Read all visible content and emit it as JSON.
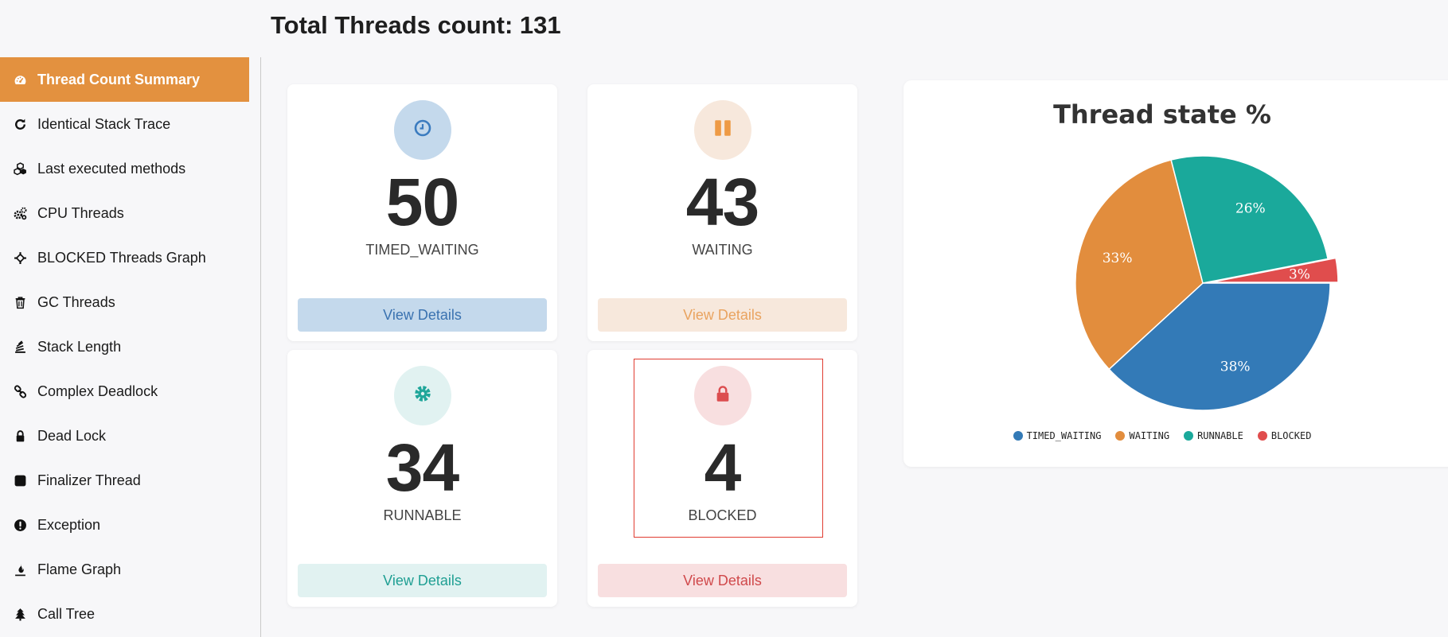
{
  "header": {
    "title": "Total Threads count: 131"
  },
  "sidebar": {
    "items": [
      {
        "label": "Thread Count Summary",
        "icon": "dashboard-icon",
        "active": true
      },
      {
        "label": "Identical Stack Trace",
        "icon": "refresh-icon"
      },
      {
        "label": "Last executed methods",
        "icon": "cubes-icon"
      },
      {
        "label": "CPU Threads",
        "icon": "cogs-icon"
      },
      {
        "label": "BLOCKED Threads Graph",
        "icon": "crosshairs-icon"
      },
      {
        "label": "GC Threads",
        "icon": "trash-icon"
      },
      {
        "label": "Stack Length",
        "icon": "stack-icon"
      },
      {
        "label": "Complex Deadlock",
        "icon": "link-icon"
      },
      {
        "label": "Dead Lock",
        "icon": "lock-icon"
      },
      {
        "label": "Finalizer Thread",
        "icon": "square-icon"
      },
      {
        "label": "Exception",
        "icon": "exclamation-circle-icon"
      },
      {
        "label": "Flame Graph",
        "icon": "fire-icon"
      },
      {
        "label": "Call Tree",
        "icon": "tree-icon"
      }
    ]
  },
  "cards": [
    {
      "count": "50",
      "state": "TIMED_WAITING",
      "button": "View Details",
      "icon": "clock-icon",
      "circle_bg": "#c4d9ec",
      "icon_color": "#3a7bbf",
      "btn_bg": "#c4d9ec",
      "btn_color": "#3a72b0"
    },
    {
      "count": "43",
      "state": "WAITING",
      "button": "View Details",
      "icon": "pause-icon",
      "circle_bg": "#f7e8dc",
      "icon_color": "#ee9a45",
      "btn_bg": "#f7e8dc",
      "btn_color": "#e9a35f"
    },
    {
      "count": "34",
      "state": "RUNNABLE",
      "button": "View Details",
      "icon": "gear-icon",
      "circle_bg": "#e1f2f1",
      "icon_color": "#1fa69a",
      "btn_bg": "#e1f2f1",
      "btn_color": "#1f9f93"
    },
    {
      "count": "4",
      "state": "BLOCKED",
      "button": "View Details",
      "icon": "lock-icon",
      "circle_bg": "#f8dfe0",
      "icon_color": "#dc4d4f",
      "btn_bg": "#f8dfe0",
      "btn_color": "#d0494b"
    }
  ],
  "chart_data": {
    "type": "pie",
    "title": "Thread state %",
    "series": [
      {
        "name": "TIMED_WAITING",
        "value": 50,
        "label": "38%",
        "color": "#337ab7"
      },
      {
        "name": "WAITING",
        "value": 43,
        "label": "33%",
        "color": "#e28d3d"
      },
      {
        "name": "RUNNABLE",
        "value": 34,
        "label": "26%",
        "color": "#1aa99b"
      },
      {
        "name": "BLOCKED",
        "value": 4,
        "label": "3%",
        "color": "#e04d4d"
      }
    ],
    "legend_position": "bottom",
    "highlighted": "BLOCKED"
  }
}
